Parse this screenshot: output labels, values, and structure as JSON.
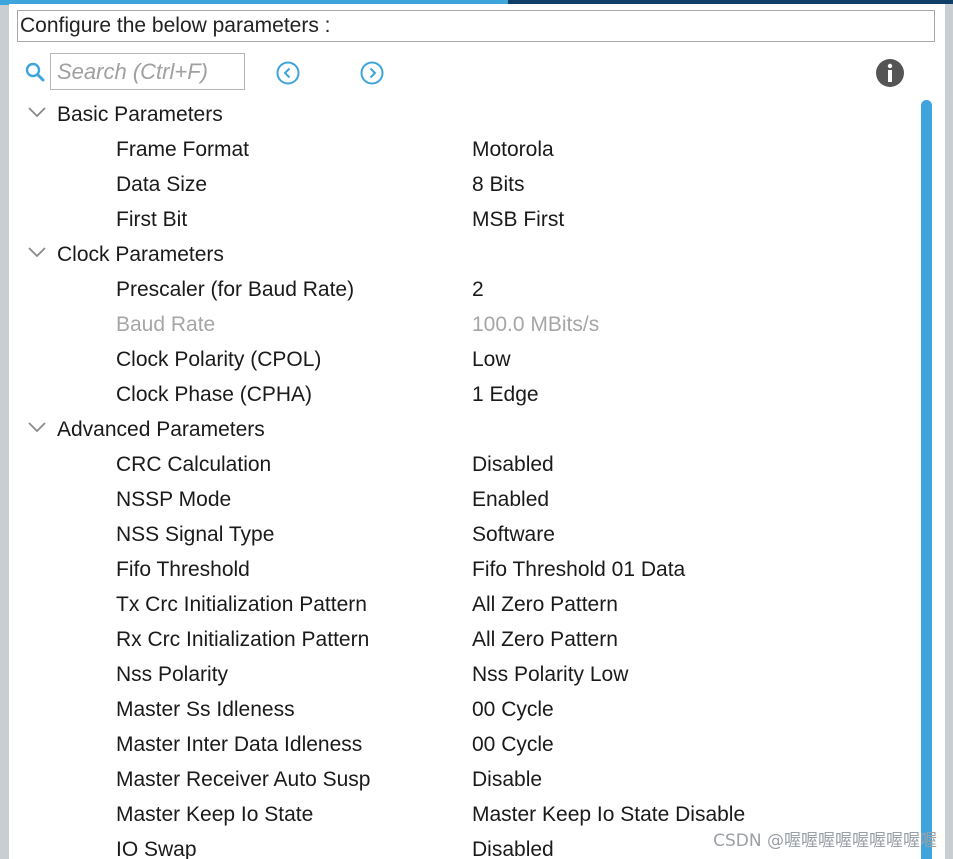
{
  "header": {
    "title": "Configure the below parameters :"
  },
  "search": {
    "placeholder": "Search (Ctrl+F)"
  },
  "icons": {
    "search": "search-icon",
    "previous": "chevron-left-circle-icon",
    "next": "chevron-right-circle-icon",
    "info": "info-icon",
    "accent": "#3ea4dc"
  },
  "sections": [
    {
      "label": "Basic Parameters",
      "params": [
        {
          "name": "Frame Format",
          "value": "Motorola"
        },
        {
          "name": "Data Size",
          "value": "8 Bits"
        },
        {
          "name": "First Bit",
          "value": "MSB First"
        }
      ]
    },
    {
      "label": "Clock Parameters",
      "params": [
        {
          "name": "Prescaler (for Baud Rate)",
          "value": "2"
        },
        {
          "name": "Baud Rate",
          "value": "100.0 MBits/s",
          "disabled": true
        },
        {
          "name": "Clock Polarity (CPOL)",
          "value": "Low"
        },
        {
          "name": "Clock Phase (CPHA)",
          "value": "1 Edge"
        }
      ]
    },
    {
      "label": "Advanced Parameters",
      "params": [
        {
          "name": "CRC Calculation",
          "value": "Disabled"
        },
        {
          "name": "NSSP Mode",
          "value": "Enabled"
        },
        {
          "name": "NSS Signal Type",
          "value": "Software"
        },
        {
          "name": "Fifo Threshold",
          "value": "Fifo Threshold 01 Data"
        },
        {
          "name": "Tx Crc Initialization Pattern",
          "value": "All Zero Pattern"
        },
        {
          "name": "Rx Crc Initialization Pattern",
          "value": "All Zero Pattern"
        },
        {
          "name": "Nss Polarity",
          "value": "Nss Polarity Low"
        },
        {
          "name": "Master Ss Idleness",
          "value": "00 Cycle"
        },
        {
          "name": "Master Inter Data Idleness",
          "value": "00 Cycle"
        },
        {
          "name": "Master Receiver Auto Susp",
          "value": "Disable"
        },
        {
          "name": "Master Keep Io State",
          "value": "Master Keep Io State Disable"
        },
        {
          "name": "IO Swap",
          "value": "Disabled"
        }
      ]
    }
  ],
  "watermark": "CSDN @喔喔喔喔喔喔喔喔喔"
}
